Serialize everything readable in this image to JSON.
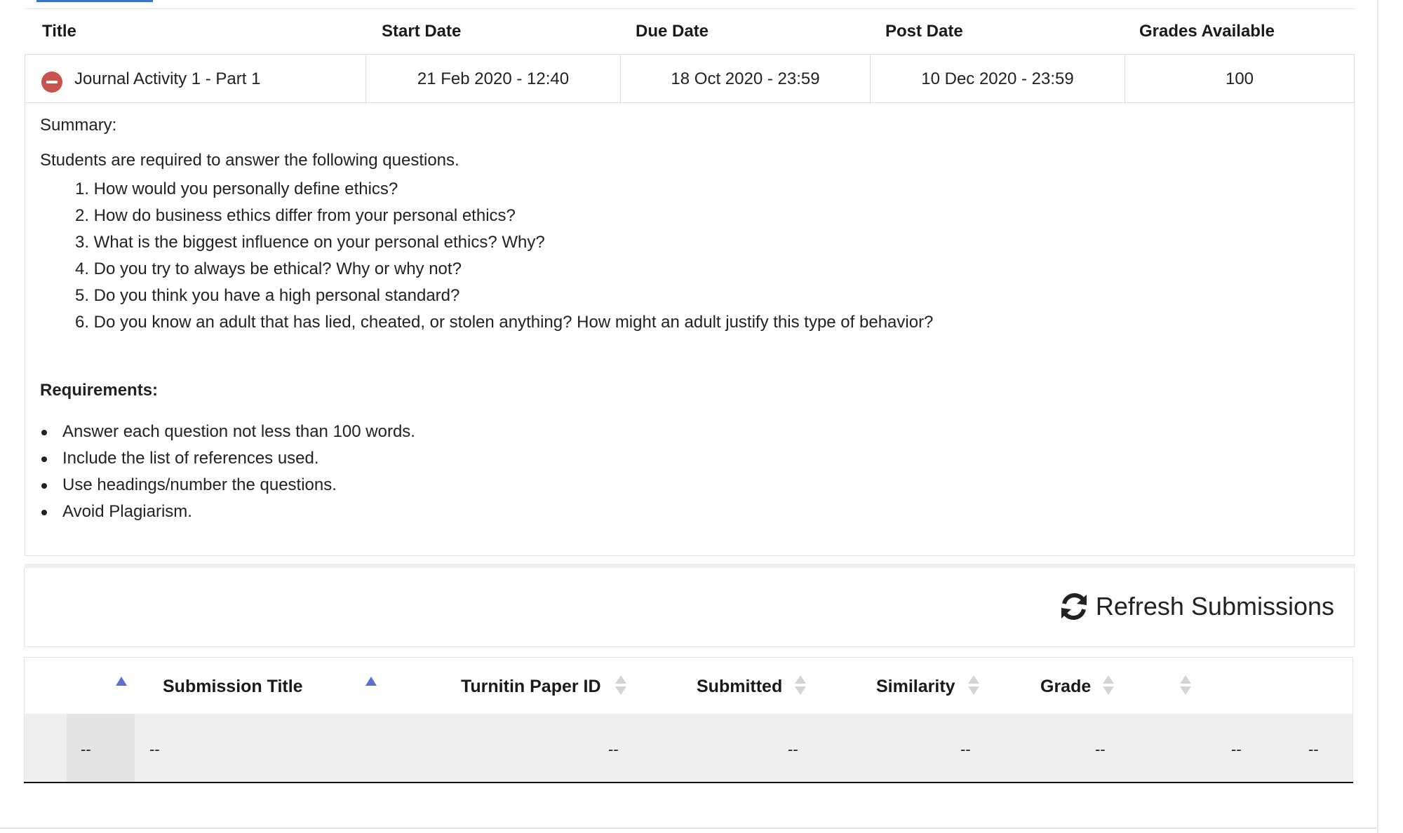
{
  "assignment_table": {
    "headers": {
      "title": "Title",
      "start_date": "Start Date",
      "due_date": "Due Date",
      "post_date": "Post Date",
      "grades_available": "Grades Available"
    },
    "row": {
      "title": "Journal Activity 1 - Part 1",
      "start_date": "21 Feb 2020 - 12:40",
      "due_date": "18 Oct 2020 - 23:59",
      "post_date": "10 Dec 2020 - 23:59",
      "grades_available": "100",
      "status_icon": "minus-circle-icon",
      "status_color": "#c9534f"
    }
  },
  "details": {
    "summary_label": "Summary:",
    "intro": "Students are required to answer the following questions.",
    "questions": [
      "1. How would you personally define ethics?",
      "2. How do business ethics differ from your personal ethics?",
      "3. What is the biggest influence on your personal ethics? Why?",
      "4. Do you try to always be ethical? Why or why not?",
      "5. Do you think you have a high personal standard?",
      "6. Do you know an adult that has lied, cheated, or stolen anything? How might an adult justify this type of behavior?"
    ],
    "requirements_label": "Requirements:",
    "requirements": [
      "Answer each question not less than 100 words.",
      "Include the list of references used.",
      "Use headings/number the questions.",
      "Avoid Plagiarism."
    ]
  },
  "refresh": {
    "label": "Refresh Submissions",
    "icon": "refresh-icon"
  },
  "submissions_table": {
    "headers": {
      "submission_title": "Submission Title",
      "turnitin_paper_id": "Turnitin Paper ID",
      "submitted": "Submitted",
      "similarity": "Similarity",
      "grade": "Grade"
    },
    "row": [
      "--",
      "--",
      "--",
      "--",
      "--",
      "--",
      "--",
      "--"
    ],
    "sort_active_color": "#5b6fd6",
    "sort_inactive_color": "#d4d4d4"
  }
}
